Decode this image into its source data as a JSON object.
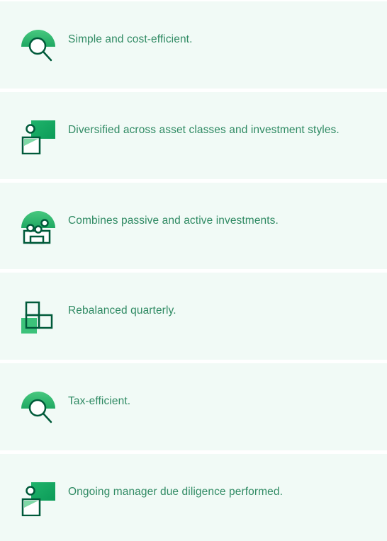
{
  "colors": {
    "card_background": "#f1faf6",
    "text": "#2f8a63",
    "icon_green_dark": "#005a3a",
    "icon_green_mid": "#1fb36b",
    "icon_green_light": "#5fd08e"
  },
  "features": [
    {
      "icon": "magnifier-icon",
      "label": "Simple and cost-efficient."
    },
    {
      "icon": "person-board-icon",
      "label": "Diversified across asset classes and investment styles."
    },
    {
      "icon": "group-icon",
      "label": "Combines passive and active investments."
    },
    {
      "icon": "blocks-icon",
      "label": "Rebalanced quarterly."
    },
    {
      "icon": "magnifier-icon",
      "label": "Tax-efficient."
    },
    {
      "icon": "person-board-icon",
      "label": "Ongoing manager due diligence performed."
    }
  ]
}
